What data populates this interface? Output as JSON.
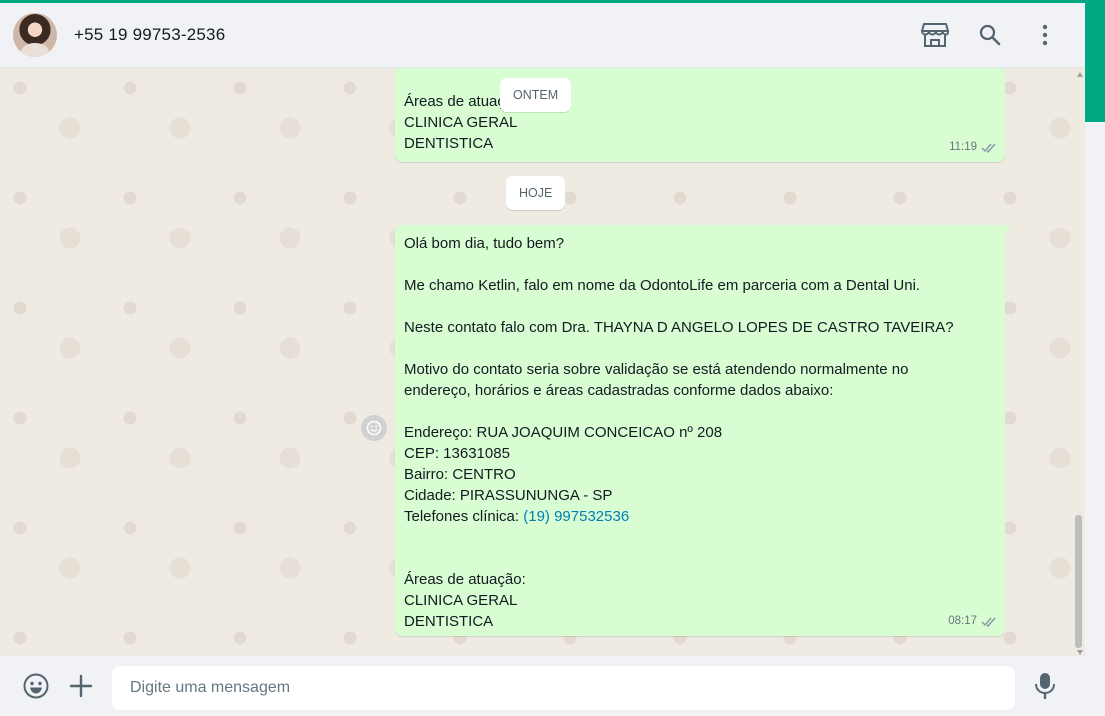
{
  "header": {
    "contact_name": "+55 19 99753-2536",
    "icons": [
      "catalog-store-icon",
      "search-icon",
      "menu-dots-icon"
    ]
  },
  "chat": {
    "date_chips": [
      "ONTEM",
      "HOJE"
    ],
    "previous_message": {
      "lines": [
        "Áreas de atuaç",
        "CLINICA GERAL",
        "DENTISTICA"
      ],
      "time": "11:19",
      "status": "read-double-check"
    },
    "message": {
      "lines": [
        "Olá bom dia, tudo bem?",
        "",
        "Me chamo Ketlin, falo em nome da OdontoLife em parceria com a Dental Uni.",
        "",
        "Neste contato falo com Dra. THAYNA D ANGELO LOPES DE CASTRO TAVEIRA?",
        "",
        "Motivo do contato seria sobre validação se está atendendo normalmente no",
        "endereço, horários e áreas cadastradas conforme dados abaixo:",
        "",
        "Endereço: RUA JOAQUIM CONCEICAO nº 208",
        "CEP: 13631085",
        "Bairro: CENTRO",
        "Cidade: PIRASSUNUNGA - SP"
      ],
      "phone_label": "Telefones clínica: ",
      "phone_link": "(19) 997532536",
      "areas": [
        "Áreas de atuação:",
        "CLINICA GERAL",
        "DENTISTICA"
      ],
      "time": "08:17",
      "status": "read-double-check"
    }
  },
  "footer": {
    "placeholder": "Digite uma mensagem",
    "icons": [
      "emoji-icon",
      "attach-plus-icon",
      "microphone-icon"
    ]
  },
  "colors": {
    "accent": "#00a884",
    "outgoing_bubble": "#d9fdd3",
    "link": "#027eb5",
    "chat_background": "#efeae2"
  }
}
